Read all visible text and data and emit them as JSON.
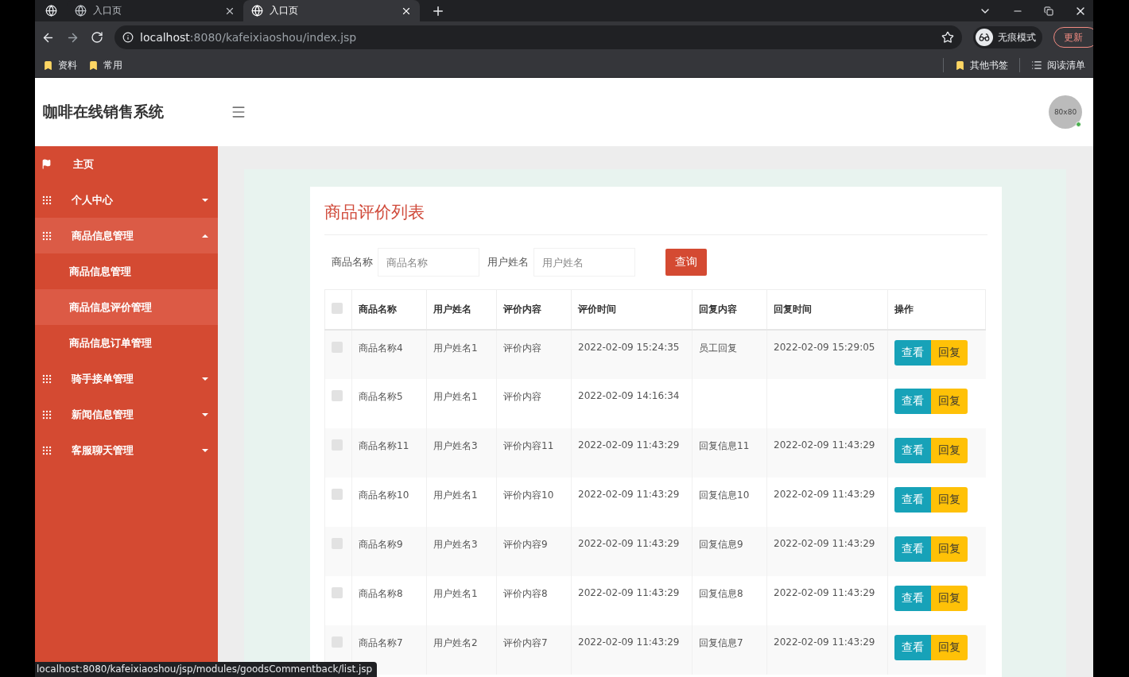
{
  "browser": {
    "tabs": [
      {
        "title": "入口页",
        "selected": false
      },
      {
        "title": "入口页",
        "selected": true
      }
    ],
    "url_host": "localhost",
    "url_path": ":8080/kafeixiaoshou/index.jsp",
    "profile": "无痕模式",
    "update_button": "更新",
    "bookmarks": [
      "资料",
      "常用"
    ],
    "other_bookmarks": "其他书签",
    "reading_list": "阅读清单",
    "status_url": "localhost:8080/kafeixiaoshou/jsp/modules/goodsCommentback/list.jsp"
  },
  "header": {
    "title": "咖啡在线销售系统",
    "avatar_label": "80x80"
  },
  "sidebar": {
    "items": [
      {
        "label": "主页",
        "kind": "flag",
        "expanded": false
      },
      {
        "label": "个人中心",
        "kind": "grid",
        "expanded": false
      },
      {
        "label": "商品信息管理",
        "kind": "grid",
        "expanded": true,
        "children": [
          {
            "label": "商品信息管理",
            "selected": false
          },
          {
            "label": "商品信息评价管理",
            "selected": true
          },
          {
            "label": "商品信息订单管理",
            "selected": false
          }
        ]
      },
      {
        "label": "骑手接单管理",
        "kind": "grid",
        "expanded": false
      },
      {
        "label": "新闻信息管理",
        "kind": "grid",
        "expanded": false
      },
      {
        "label": "客服聊天管理",
        "kind": "grid",
        "expanded": false
      }
    ]
  },
  "panel": {
    "title": "商品评价列表",
    "filters": [
      {
        "label": "商品名称",
        "placeholder": "商品名称"
      },
      {
        "label": "用户姓名",
        "placeholder": "用户姓名"
      }
    ],
    "search_button": "查询",
    "table": {
      "select_all_checked": false,
      "columns": [
        "商品名称",
        "用户姓名",
        "评价内容",
        "评价时间",
        "回复内容",
        "回复时间",
        "操作"
      ],
      "rows": [
        {
          "checked": false,
          "cells": [
            "商品名称4",
            "用户姓名1",
            "评价内容",
            "2022-02-09 15:24:35",
            "员工回复",
            "2022-02-09 15:29:05"
          ],
          "actions": [
            "查看",
            "回复"
          ]
        },
        {
          "checked": false,
          "cells": [
            "商品名称5",
            "用户姓名1",
            "评价内容",
            "2022-02-09 14:16:34"
          ],
          "actions": [
            "查看",
            "回复"
          ]
        },
        {
          "checked": false,
          "cells": [
            "商品名称11",
            "用户姓名3",
            "评价内容11",
            "2022-02-09 11:43:29",
            "回复信息11",
            "2022-02-09 11:43:29"
          ],
          "actions": [
            "查看",
            "回复"
          ]
        },
        {
          "checked": false,
          "cells": [
            "商品名称10",
            "用户姓名1",
            "评价内容10",
            "2022-02-09 11:43:29",
            "回复信息10",
            "2022-02-09 11:43:29"
          ],
          "actions": [
            "查看",
            "回复"
          ]
        },
        {
          "checked": false,
          "cells": [
            "商品名称9",
            "用户姓名3",
            "评价内容9",
            "2022-02-09 11:43:29",
            "回复信息9",
            "2022-02-09 11:43:29"
          ],
          "actions": [
            "查看",
            "回复"
          ]
        },
        {
          "checked": false,
          "cells": [
            "商品名称8",
            "用户姓名1",
            "评价内容8",
            "2022-02-09 11:43:29",
            "回复信息8",
            "2022-02-09 11:43:29"
          ],
          "actions": [
            "查看",
            "回复"
          ]
        },
        {
          "checked": false,
          "cells": [
            "商品名称7",
            "用户姓名2",
            "评价内容7",
            "2022-02-09 11:43:29",
            "回复信息7",
            "2022-02-09 11:43:29"
          ],
          "actions": [
            "查看",
            "回复"
          ]
        }
      ]
    }
  }
}
